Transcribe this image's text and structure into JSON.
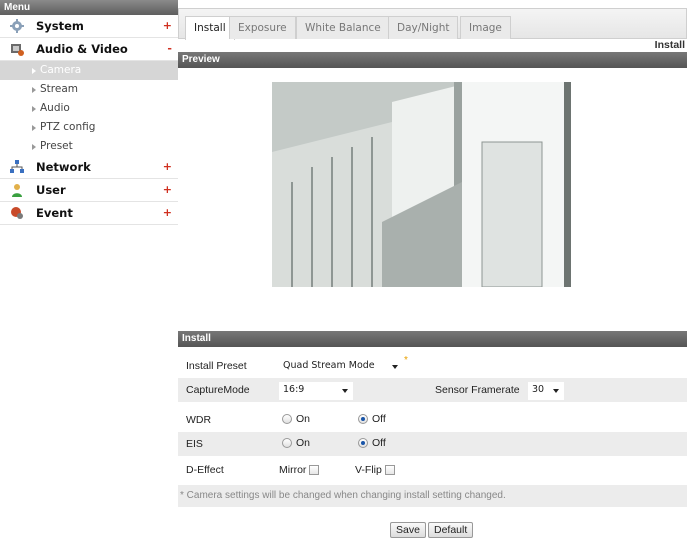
{
  "sidebar": {
    "header": "Menu",
    "sections": [
      {
        "label": "System",
        "toggle": "+"
      },
      {
        "label": "Audio & Video",
        "toggle": "-"
      },
      {
        "label": "Network",
        "toggle": "+"
      },
      {
        "label": "User",
        "toggle": "+"
      },
      {
        "label": "Event",
        "toggle": "+"
      }
    ],
    "subitems": [
      "Camera",
      "Stream",
      "Audio",
      "PTZ config",
      "Preset"
    ]
  },
  "tabs": [
    "Install",
    "Exposure",
    "White Balance",
    "Day/Night",
    "Image"
  ],
  "page_label": "Install",
  "preview": {
    "title": "Preview"
  },
  "install": {
    "title": "Install",
    "install_preset": {
      "label": "Install Preset",
      "value": "Quad Stream Mode",
      "required_mark": "*"
    },
    "capture_mode": {
      "label": "CaptureMode",
      "value": "16:9"
    },
    "sensor_framerate": {
      "label": "Sensor Framerate",
      "value": "30"
    },
    "wdr": {
      "label": "WDR",
      "on": "On",
      "off": "Off",
      "selected": "Off"
    },
    "eis": {
      "label": "EIS",
      "on": "On",
      "off": "Off",
      "selected": "Off"
    },
    "d_effect": {
      "label": "D-Effect",
      "mirror": "Mirror",
      "vflip": "V-Flip"
    },
    "note": "* Camera settings will be changed when changing install setting changed.",
    "save": "Save",
    "default": "Default"
  },
  "colors": {
    "accent_red": "#d03020",
    "header_gray": "#5e5e5e",
    "active_sub": "#d6d6d6"
  }
}
